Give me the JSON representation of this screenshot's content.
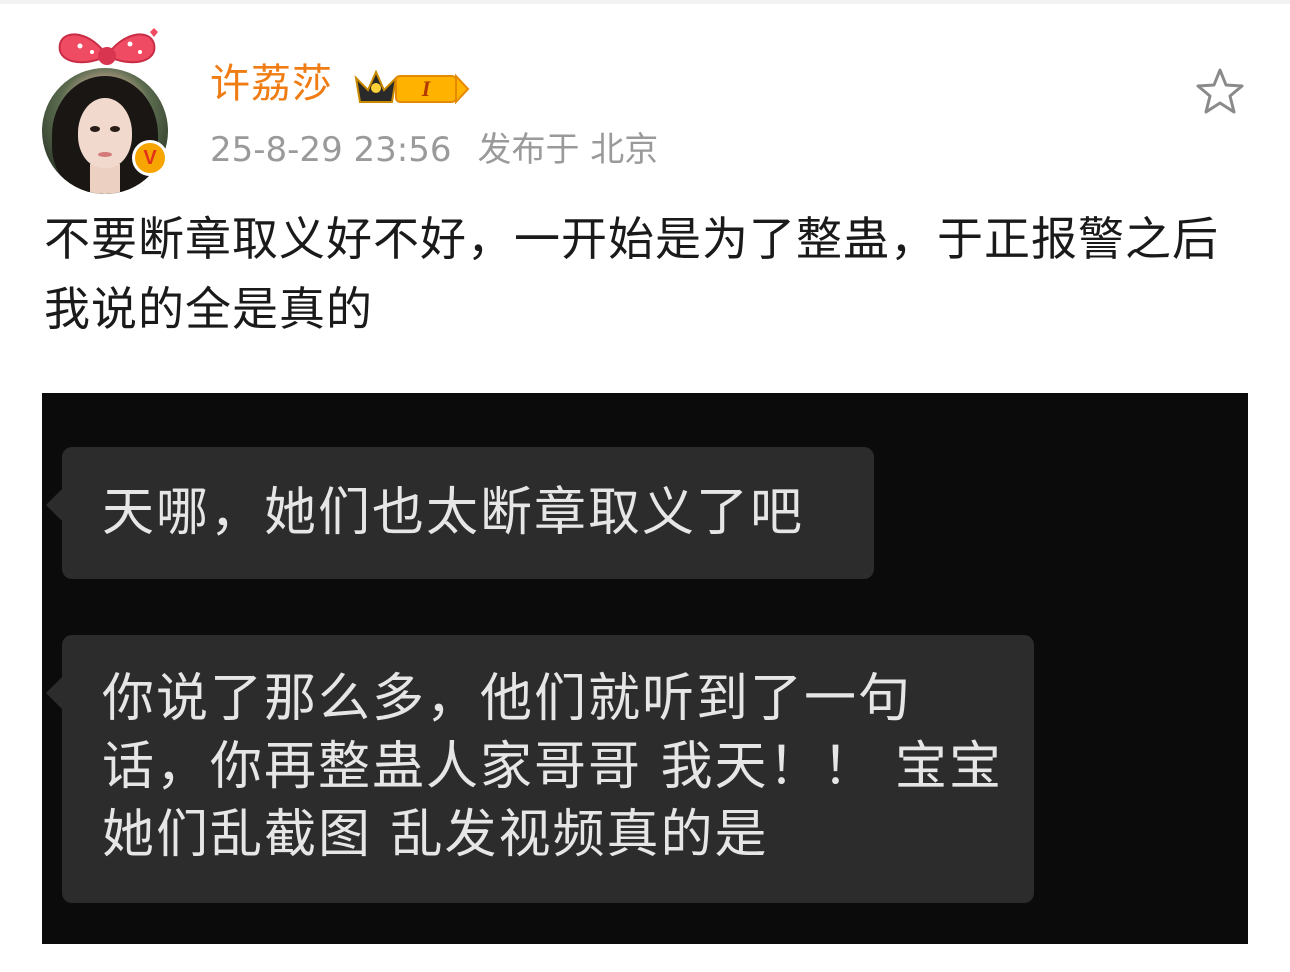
{
  "post": {
    "author": {
      "name": "许荔莎",
      "verified_badge": "V",
      "level_badge": "I",
      "badge_icon": "crown-icon",
      "avatar_accent_color": "#e8334a"
    },
    "time": "25-8-29 23:56",
    "location": "发布于 北京",
    "favorite_icon": "star-outline-icon",
    "text": "不要断章取义好不好，一开始是为了整蛊，于正报警之后我说的全是真的"
  },
  "screenshot": {
    "messages": [
      {
        "text": "天哪，她们也太断章取义了吧"
      },
      {
        "text": "你说了那么多，他们就听到了一句话，你再整蛊人家哥哥 我天！！ 宝宝她们乱截图 乱发视频真的是"
      }
    ]
  },
  "colors": {
    "username": "#f07c14",
    "meta": "#9a9a9a",
    "bubble_bg": "#2c2c2c",
    "screenshot_bg": "#0b0b0b"
  }
}
